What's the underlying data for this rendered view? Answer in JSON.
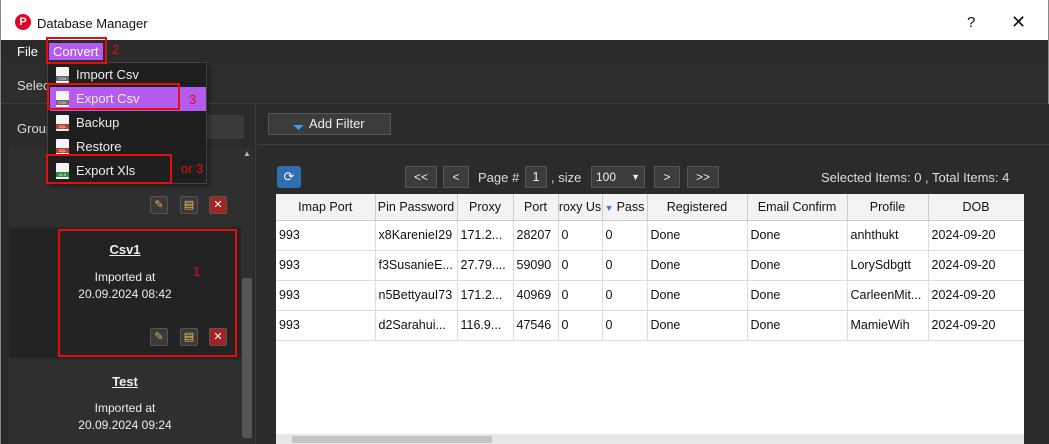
{
  "window": {
    "title": "Database Manager",
    "help": "?",
    "close": "✕"
  },
  "menu": {
    "file": "File",
    "convert": "Convert"
  },
  "dropdown": {
    "items": [
      {
        "label": "Import Csv",
        "tag": "CSV",
        "tag_color": "#6a6a6a"
      },
      {
        "label": "Export Csv",
        "tag": "CSV",
        "tag_color": "#6a6a6a"
      },
      {
        "label": "Backup",
        "tag": "SQL",
        "tag_color": "#c0392b"
      },
      {
        "label": "Restore",
        "tag": "SQL",
        "tag_color": "#c0392b"
      },
      {
        "label": "Export Xls",
        "tag": "XLS",
        "tag_color": "#2e8b3a"
      }
    ]
  },
  "annotations": {
    "n1": "1",
    "n2": "2",
    "n3": "3",
    "n4": "or 3"
  },
  "select_bar": {
    "label": "Selec"
  },
  "left": {
    "group_label": "Group",
    "cards": [
      {
        "name": "Csv1",
        "line1": "Imported at",
        "line2": "20.09.2024 08:42"
      },
      {
        "name": "Test",
        "line1": "Imported at",
        "line2": "20.09.2024 09:24"
      }
    ]
  },
  "toolbar": {
    "add_filter": "Add Filter"
  },
  "pager": {
    "first": "<<",
    "prev": "<",
    "page_label": "Page #",
    "page_num": "1",
    "size_label": ", size",
    "size_value": "100",
    "next": ">",
    "last": ">>",
    "selected_info": "Selected Items:  0  , Total Items:  4"
  },
  "table": {
    "headers": [
      "Imap Port",
      "Pin Password",
      "Proxy",
      "Port",
      "roxy Us",
      "Pass",
      "Registered",
      "Email Confirm",
      "Profile",
      "DOB"
    ],
    "rows": [
      [
        "993",
        "x8KarenieI29",
        "171.2...",
        "28207",
        "0",
        "0",
        "Done",
        "Done",
        "anhthukt",
        "2024-09-20"
      ],
      [
        "993",
        "f3SusanieE...",
        "27.79....",
        "59090",
        "0",
        "0",
        "Done",
        "Done",
        "LorySdbgtt",
        "2024-09-20"
      ],
      [
        "993",
        "n5BettyauI73",
        "171.2...",
        "40969",
        "0",
        "0",
        "Done",
        "Done",
        "CarleenMit...",
        "2024-09-20"
      ],
      [
        "993",
        "d2Sarahui...",
        "116.9...",
        "47546",
        "0",
        "0",
        "Done",
        "Done",
        "MamieWih",
        "2024-09-20"
      ]
    ]
  },
  "colors": {
    "accent": "#b45cf0",
    "annotation": "#e01010",
    "refresh": "#2f6fb0"
  }
}
